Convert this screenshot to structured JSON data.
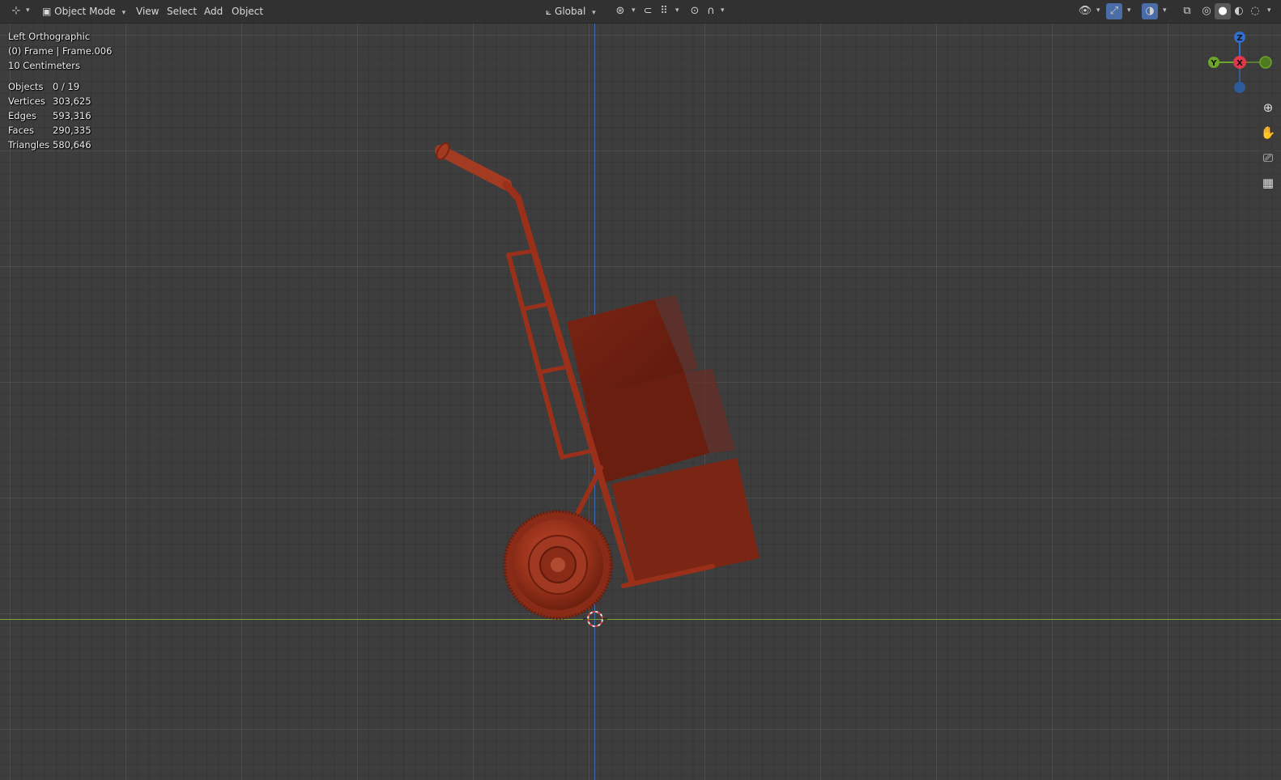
{
  "header": {
    "editor_type_icon": "axes-icon",
    "mode_label": "Object Mode",
    "menus": [
      "View",
      "Select",
      "Add",
      "Object"
    ],
    "transform_orientation": "Global"
  },
  "overlay": {
    "view_name": "Left Orthographic",
    "collection_info": "(0) Frame | Frame.006",
    "scale_info": "10 Centimeters"
  },
  "stats": {
    "objects": {
      "label": "Objects",
      "value": "0 / 19"
    },
    "vertices": {
      "label": "Vertices",
      "value": "303,625"
    },
    "edges": {
      "label": "Edges",
      "value": "593,316"
    },
    "faces": {
      "label": "Faces",
      "value": "290,335"
    },
    "triangles": {
      "label": "Triangles",
      "value": "580,646"
    }
  },
  "gizmo": {
    "z_label": "Z",
    "x_label": "X",
    "y_label": "Y",
    "z_color": "#2f6fcf",
    "x_color": "#e0384b",
    "y_color": "#6ca62a"
  },
  "colors": {
    "viewport_bg": "#3d3d3d",
    "model_red": "#8a2a18"
  }
}
